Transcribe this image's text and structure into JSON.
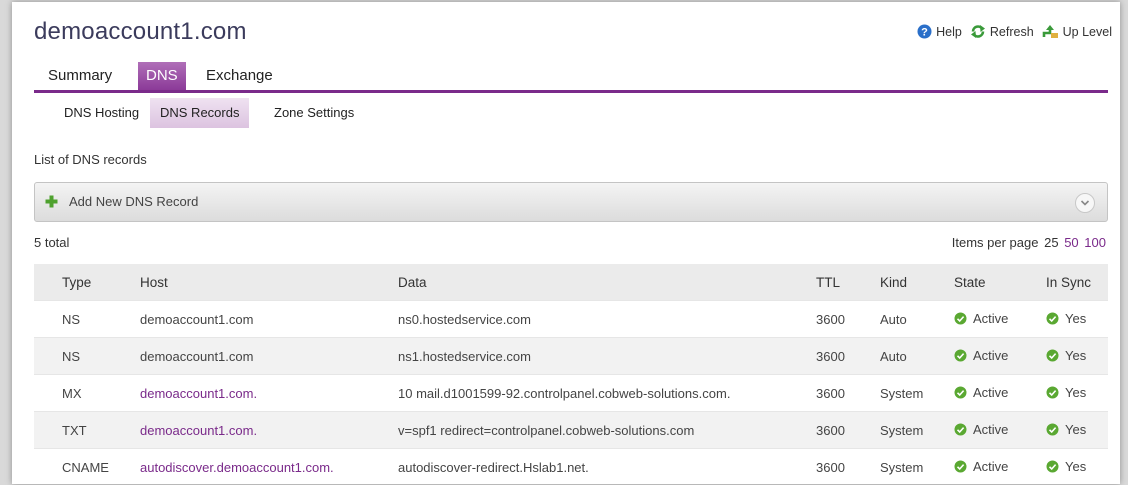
{
  "header": {
    "title": "demoaccount1.com",
    "links": [
      {
        "label": "Help",
        "icon": "help-icon"
      },
      {
        "label": "Refresh",
        "icon": "refresh-icon"
      },
      {
        "label": "Up Level",
        "icon": "up-level-icon"
      }
    ]
  },
  "main_tabs": [
    "Summary",
    "DNS",
    "Exchange"
  ],
  "active_main_tab": "DNS",
  "sub_tabs": [
    "DNS Hosting",
    "DNS Records",
    "Zone Settings"
  ],
  "active_sub_tab": "DNS Records",
  "list_heading": "List of DNS records",
  "add_record": {
    "label": "Add New DNS Record"
  },
  "summary": {
    "total": "5 total",
    "items_per_page_label": "Items per page",
    "page_sizes": [
      "25",
      "50",
      "100"
    ]
  },
  "table": {
    "columns": [
      "Type",
      "Host",
      "Data",
      "TTL",
      "Kind",
      "State",
      "In Sync"
    ],
    "rows": [
      {
        "type": "NS",
        "host": "demoaccount1.com",
        "host_link": false,
        "data": "ns0.hostedservice.com",
        "ttl": "3600",
        "kind": "Auto",
        "state": "Active",
        "sync": "Yes"
      },
      {
        "type": "NS",
        "host": "demoaccount1.com",
        "host_link": false,
        "data": "ns1.hostedservice.com",
        "ttl": "3600",
        "kind": "Auto",
        "state": "Active",
        "sync": "Yes"
      },
      {
        "type": "MX",
        "host": "demoaccount1.com.",
        "host_link": true,
        "data": "10 mail.d1001599-92.controlpanel.cobweb-solutions.com.",
        "ttl": "3600",
        "kind": "System",
        "state": "Active",
        "sync": "Yes"
      },
      {
        "type": "TXT",
        "host": "demoaccount1.com.",
        "host_link": true,
        "data": "v=spf1 redirect=controlpanel.cobweb-solutions.com",
        "ttl": "3600",
        "kind": "System",
        "state": "Active",
        "sync": "Yes"
      },
      {
        "type": "CNAME",
        "host": "autodiscover.demoaccount1.com.",
        "host_link": true,
        "data": "autodiscover-redirect.Hslab1.net.",
        "ttl": "3600",
        "kind": "System",
        "state": "Active",
        "sync": "Yes"
      }
    ]
  },
  "colors": {
    "accent": "#7a2a8a",
    "status_ok": "#5aa832",
    "help_blue": "#2a6fc9"
  }
}
